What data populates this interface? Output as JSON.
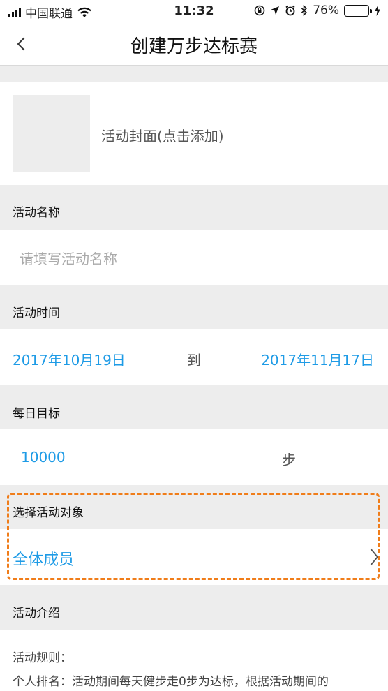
{
  "status_bar": {
    "carrier": "中国联通",
    "time": "11:32",
    "battery_percent": "76%",
    "battery_level": 0.76,
    "icons": [
      "signal-icon",
      "wifi-icon",
      "rotation-lock-icon",
      "location-icon",
      "alarm-icon",
      "bluetooth-icon",
      "battery-icon",
      "charging-icon"
    ]
  },
  "nav": {
    "title": "创建万步达标赛",
    "back_icon": "chevron-left-icon"
  },
  "cover": {
    "label": "活动封面(点击添加)"
  },
  "activity_name": {
    "label": "活动名称",
    "placeholder": "请填写活动名称"
  },
  "activity_time": {
    "label": "活动时间",
    "start_date": "2017年10月19日",
    "separator": "到",
    "end_date": "2017年11月17日"
  },
  "daily_goal": {
    "label": "每日目标",
    "value": "10000",
    "unit": "步"
  },
  "target": {
    "label": "选择活动对象",
    "value": "全体成员",
    "chevron_icon": "chevron-right-icon"
  },
  "intro": {
    "label": "活动介绍",
    "rules_title": "活动规则：",
    "rules_text": "个人排名：活动期间每天健步走0步为达标，根据活动期间的"
  },
  "colors": {
    "accent_blue": "#1e9be6",
    "highlight_orange": "#f07d1a",
    "section_bg": "#ededed",
    "battery_green": "#4cd964"
  }
}
